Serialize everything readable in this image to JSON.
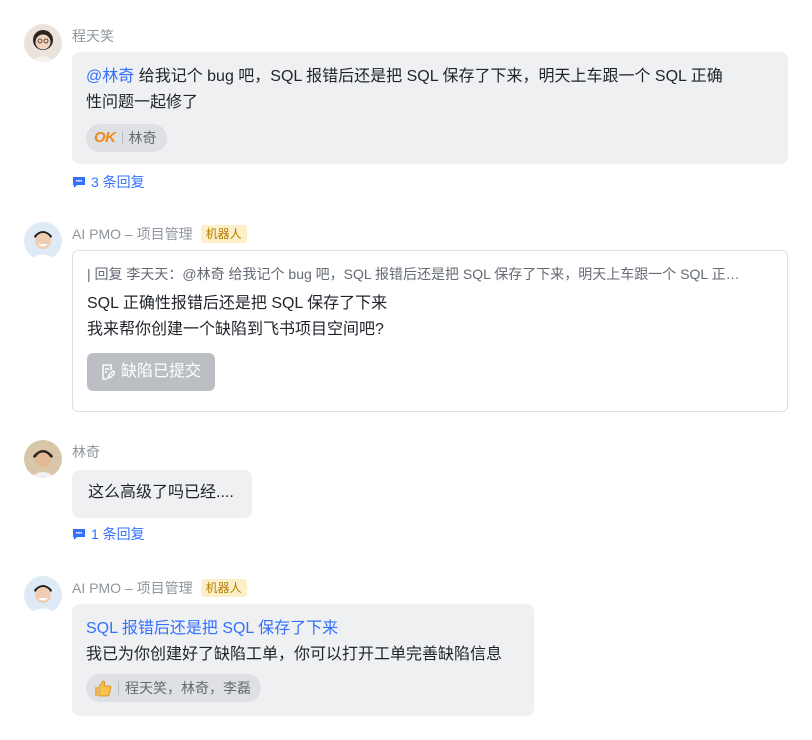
{
  "messages": [
    {
      "sender": "程天笑",
      "mention": "@林奇",
      "text_line1": " 给我记个 bug 吧，SQL 报错后还是把 SQL 保存了下来，明天上车跟一个 SQL 正确",
      "text_line2": "性问题一起修了",
      "reaction_emoji": "OK",
      "reaction_users": "林奇",
      "replies": "3 条回复"
    },
    {
      "sender": "AI PMO – 项目管理",
      "tag": "机器人",
      "quote": "| 回复 李天天：@林奇 给我记个 bug 吧，SQL 报错后还是把 SQL 保存了下来，明天上车跟一个 SQL 正…",
      "line1": "SQL 正确性报错后还是把 SQL 保存了下来",
      "line2": "我来帮你创建一个缺陷到飞书项目空间吧?",
      "button": "缺陷已提交"
    },
    {
      "sender": "林奇",
      "text": "这么高级了吗已经....",
      "replies": "1 条回复"
    },
    {
      "sender": "AI PMO – 项目管理",
      "tag": "机器人",
      "link": "SQL 报错后还是把 SQL 保存了下来",
      "text": "我已为你创建好了缺陷工单，你可以打开工单完善缺陷信息",
      "reaction_users": "程天笑，林奇，李磊"
    }
  ],
  "colors": {
    "accent": "#3370ff",
    "bubble": "#eff0f1",
    "bot_tag_bg": "#fdf0c8"
  }
}
